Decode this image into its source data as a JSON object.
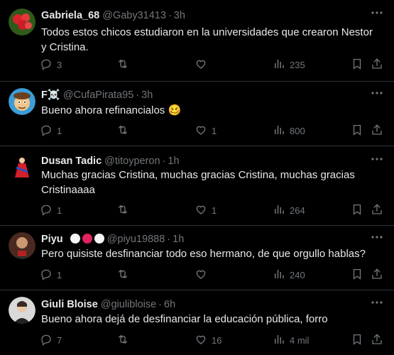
{
  "tweets": [
    {
      "name": "Gabriela_68",
      "handle": "@Gaby31413",
      "sep": "·",
      "time": "3h",
      "text": "Todos estos chicos estudiaron en la universidades que crearon Nestor y Cristina.",
      "replies": "3",
      "retweets": "",
      "likes": "",
      "views": "235"
    },
    {
      "name": "F☠️",
      "handle": "@CufaPirata95",
      "sep": "·",
      "time": "3h",
      "text": "Bueno ahora refinancialos 🥴",
      "replies": "1",
      "retweets": "",
      "likes": "1",
      "views": "800"
    },
    {
      "name": "Dusan Tadic",
      "handle": "@titoyperon",
      "sep": "·",
      "time": "1h",
      "text": "Muchas gracias Cristina, muchas gracias Cristina, muchas gracias Cristinaaaa",
      "replies": "1",
      "retweets": "",
      "likes": "1",
      "views": "264"
    },
    {
      "name": "Piyu",
      "handle": "@piyu19888",
      "sep": "·",
      "time": "1h",
      "text": "Pero quisiste desfinanciar todo eso hermano, de que orgullo hablas?",
      "replies": "1",
      "retweets": "",
      "likes": "",
      "views": "240"
    },
    {
      "name": "Giuli Bloise",
      "handle": "@giulibloise",
      "sep": "·",
      "time": "6h",
      "text": "Bueno ahora dejá de desfinanciar la educación pública, forro",
      "replies": "7",
      "retweets": "",
      "likes": "16",
      "views": "4 mil"
    }
  ],
  "icons": {
    "reply": "reply-icon",
    "retweet": "retweet-icon",
    "like": "heart-icon",
    "views": "views-icon",
    "bookmark": "bookmark-icon",
    "share": "share-icon",
    "more": "more-icon"
  },
  "colors": {
    "background": "#000000",
    "text": "#e7e9ea",
    "muted": "#71767b",
    "divider": "#2f3336"
  }
}
